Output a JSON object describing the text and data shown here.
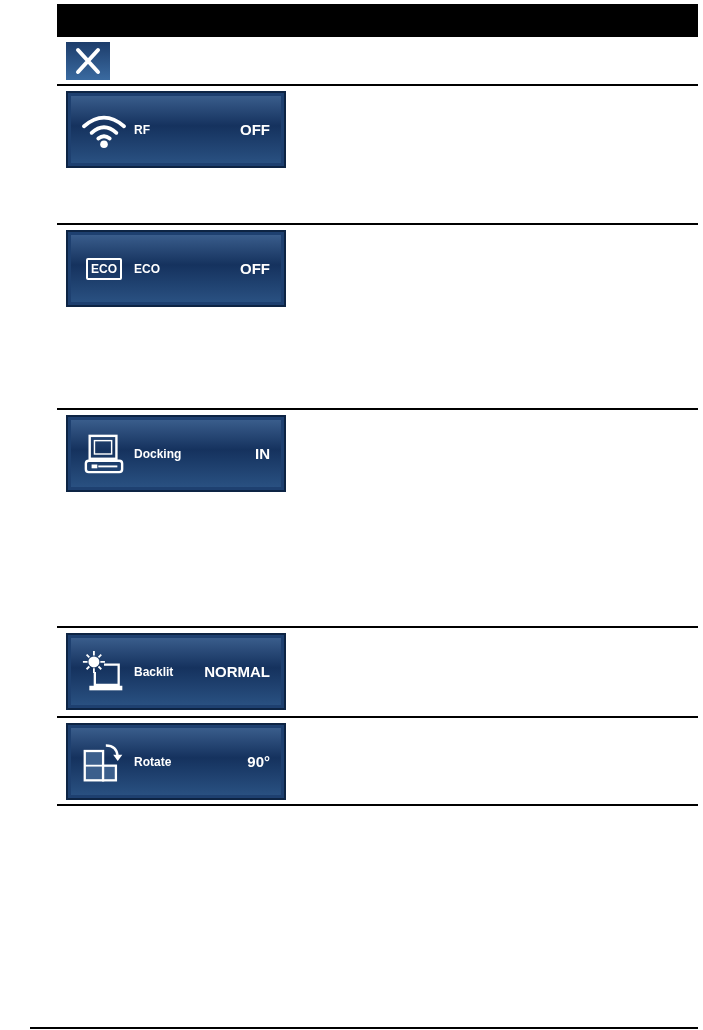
{
  "rows": [
    {
      "kind": "close"
    },
    {
      "kind": "wifi",
      "label": "RF",
      "value": "OFF"
    },
    {
      "kind": "eco",
      "icon_text": "ECO",
      "label": "ECO",
      "value": "OFF"
    },
    {
      "kind": "docking",
      "label": "Docking",
      "value": "IN"
    },
    {
      "kind": "backlit",
      "label": "Backlit",
      "value": "NORMAL"
    },
    {
      "kind": "rotate",
      "label": "Rotate",
      "value": "90°"
    }
  ]
}
